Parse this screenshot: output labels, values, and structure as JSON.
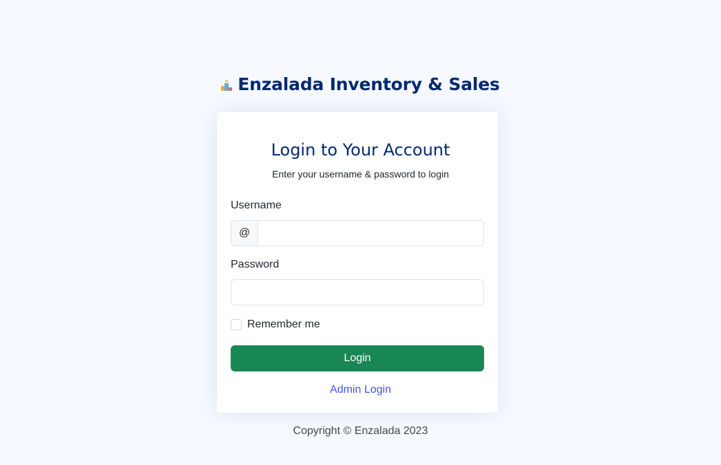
{
  "brand": {
    "title": "Enzalada Inventory & Sales",
    "logo_icon": "bar-chart-logo-icon",
    "color": "#012970"
  },
  "card": {
    "title": "Login to Your Account",
    "subtitle": "Enter your username & password to login"
  },
  "form": {
    "username_label": "Username",
    "username_prefix": "@",
    "username_value": "",
    "password_label": "Password",
    "password_value": "",
    "remember_label": "Remember me",
    "remember_checked": false,
    "login_label": "Login",
    "login_color": "#198754"
  },
  "links": {
    "admin_login": "Admin Login",
    "color": "#4154f1"
  },
  "footer": {
    "copyright": "Copyright © Enzalada 2023"
  }
}
